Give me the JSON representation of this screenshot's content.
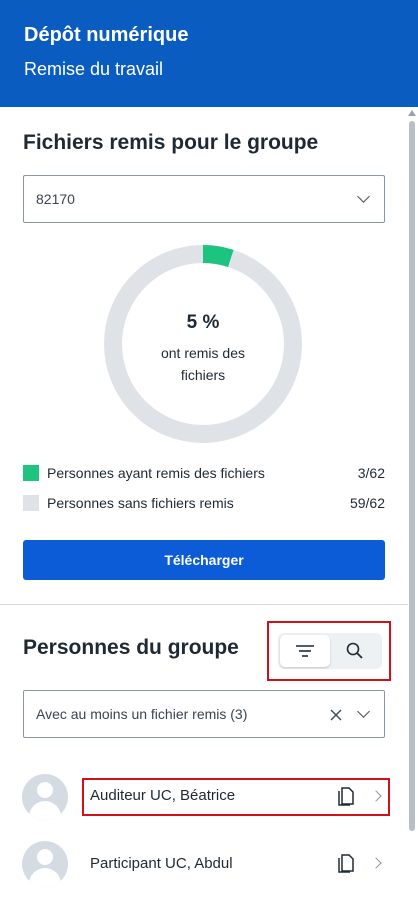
{
  "header": {
    "title": "Dépôt numérique",
    "subtitle": "Remise du travail"
  },
  "files_section": {
    "title": "Fichiers remis pour le groupe",
    "group_select": {
      "value": "82170"
    },
    "donut": {
      "percent_label": "5 %",
      "caption": "ont remis des fichiers",
      "fraction_submitted": 0.05
    },
    "legend": [
      {
        "label": "Personnes ayant remis des fichiers",
        "count": "3/62",
        "color": "#1cc47f"
      },
      {
        "label": "Personnes sans fichiers remis",
        "count": "59/62",
        "color": "#dfe3e8"
      }
    ],
    "download_label": "Télécharger"
  },
  "people_section": {
    "title": "Personnes du groupe",
    "tools": [
      {
        "icon": "filter-icon",
        "active": true
      },
      {
        "icon": "search-icon",
        "active": false
      }
    ],
    "filter_select": {
      "value": "Avec au moins un fichier remis (3)"
    },
    "people": [
      {
        "name": "Auditeur UC, Béatrice",
        "icon": "document-icon"
      },
      {
        "name": "Participant UC, Abdul",
        "icon": "document-icon"
      }
    ]
  },
  "colors": {
    "header_bg": "#0b5cc0",
    "primary_button": "#0b5cd6",
    "submitted": "#1cc47f",
    "not_submitted": "#dfe3e8",
    "highlight": "#d0101b"
  }
}
